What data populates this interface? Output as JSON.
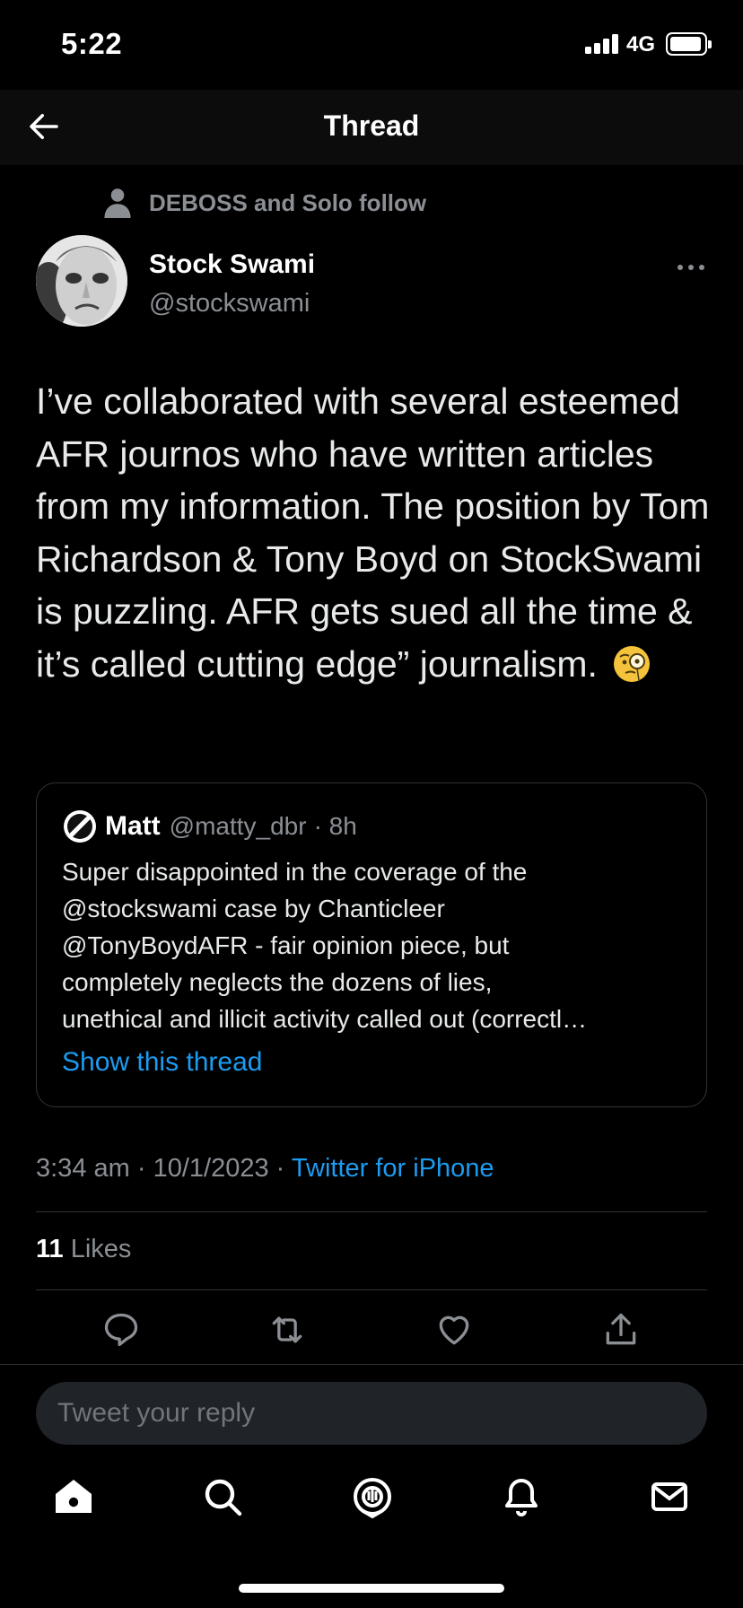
{
  "status_bar": {
    "time": "5:22",
    "network": "4G"
  },
  "header": {
    "title": "Thread"
  },
  "social_context": {
    "text": "DEBOSS and Solo follow"
  },
  "tweet": {
    "author_name": "Stock Swami",
    "author_handle": "@stockswami",
    "text": "I’ve collaborated with several esteemed AFR journos who have written articles from my information. The position by Tom Richardson & Tony Boyd on StockSwami is puzzling. AFR gets sued all the time & it’s called cutting edge” journalism.",
    "emoji": "face-with-monocle"
  },
  "quote": {
    "name": "Matt",
    "handle": "@matty_dbr",
    "time": "· 8h",
    "lines": [
      "Super disappointed in the coverage of the",
      "@stockswami case by Chanticleer",
      "@TonyBoydAFR - fair opinion piece, but",
      "completely neglects the dozens of lies,",
      "unethical and illicit activity called out (correctl…"
    ],
    "show_thread": "Show this thread"
  },
  "meta": {
    "time": "3:34 am",
    "date": "10/1/2023",
    "separator": "·",
    "source": "Twitter for iPhone"
  },
  "stats": {
    "likes_count": "11",
    "likes_label": "Likes"
  },
  "reply": {
    "placeholder": "Tweet your reply"
  },
  "colors": {
    "background": "#000000",
    "accent": "#1d9bf0",
    "muted": "#8b8f94",
    "divider": "#2f3336"
  }
}
